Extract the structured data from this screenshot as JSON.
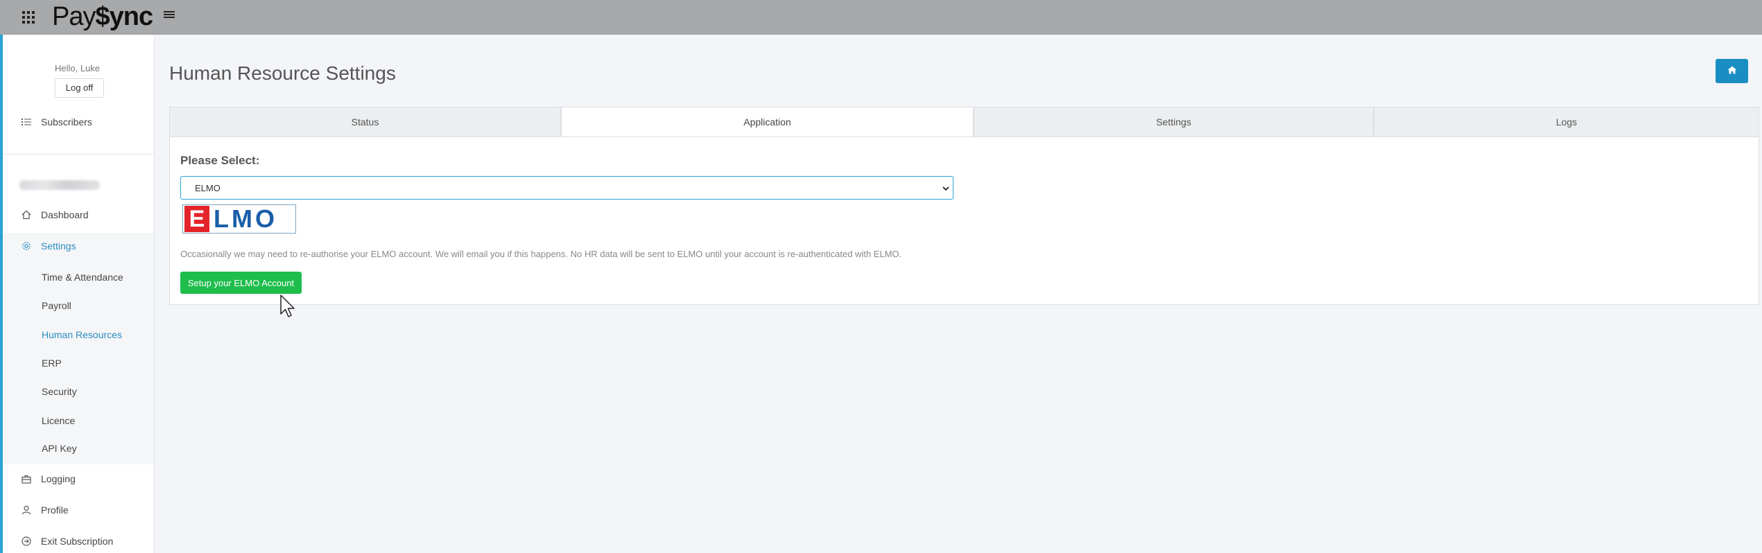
{
  "brand": {
    "name_part1": "Pay",
    "name_part2": "$ync"
  },
  "topbar": {
    "apps_icon": "grid-icon",
    "menu_icon": "hamburger-icon"
  },
  "user": {
    "greeting": "Hello, Luke",
    "logoff_label": "Log off"
  },
  "sidebar": {
    "subscribers": "Subscribers",
    "dashboard": "Dashboard",
    "settings": "Settings",
    "settings_items": [
      "Time & Attendance",
      "Payroll",
      "Human Resources",
      "ERP",
      "Security",
      "Licence",
      "API Key"
    ],
    "active_item": "Human Resources",
    "logging": "Logging",
    "profile": "Profile",
    "exit": "Exit Subscription"
  },
  "main": {
    "title": "Human Resource Settings",
    "home_icon": "home-icon",
    "tabs": [
      "Status",
      "Application",
      "Settings",
      "Logs"
    ],
    "active_tab": "Application",
    "select_label": "Please Select:",
    "select_value": "ELMO",
    "logo_letters": {
      "first": "E",
      "rest": "LMO"
    },
    "note": "Occasionally we may need to re-authorise your ELMO account. We will email you if this happens. No HR data will be sent to ELMO until your account is re-authenticated with ELMO.",
    "setup_button": "Setup your ELMO Account"
  },
  "colors": {
    "accent": "#2ba2d6",
    "active_link": "#2a8dc0",
    "setup_button": "#1ebd4c",
    "home_button": "#1a8ec2",
    "topbar": "#a8a9ab"
  }
}
